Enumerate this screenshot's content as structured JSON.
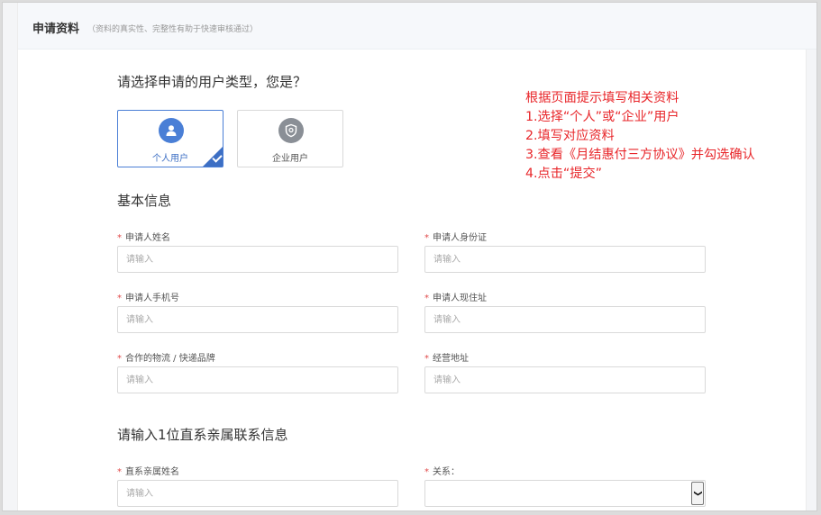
{
  "header": {
    "title": "申请资料",
    "subtitle": "（资料的真实性、完整性有助于快速审核通过）"
  },
  "user_type": {
    "question": "请选择申请的用户类型，您是？",
    "options": [
      {
        "label": "个人用户",
        "selected": true,
        "icon": "person-icon"
      },
      {
        "label": "企业用户",
        "selected": false,
        "icon": "shield-icon"
      }
    ]
  },
  "basic_info": {
    "title": "基本信息",
    "fields": [
      {
        "label": "申请人姓名",
        "placeholder": "请输入"
      },
      {
        "label": "申请人身份证",
        "placeholder": "请输入"
      },
      {
        "label": "申请人手机号",
        "placeholder": "请输入"
      },
      {
        "label": "申请人现住址",
        "placeholder": "请输入"
      },
      {
        "label": "合作的物流 / 快递品牌",
        "placeholder": "请输入"
      },
      {
        "label": "经营地址",
        "placeholder": "请输入"
      }
    ]
  },
  "relative_info": {
    "title": "请输入1位直系亲属联系信息",
    "name_label": "直系亲属姓名",
    "name_placeholder": "请输入",
    "relation_label": "关系：",
    "relation_value": ""
  },
  "required_mark": "*",
  "annotation": {
    "lines": [
      "根据页面提示填写相关资料",
      "1.选择“个人”或“企业”用户",
      "2.填写对应资料",
      "3.查看《月结惠付三方协议》并勾选确认",
      "4.点击“提交”"
    ],
    "color": "#e8262a"
  },
  "colors": {
    "accent": "#3d6fc4",
    "person_icon_bg": "#4a7fd6",
    "shield_icon_bg": "#8a8f96",
    "required": "#e14b4b"
  }
}
